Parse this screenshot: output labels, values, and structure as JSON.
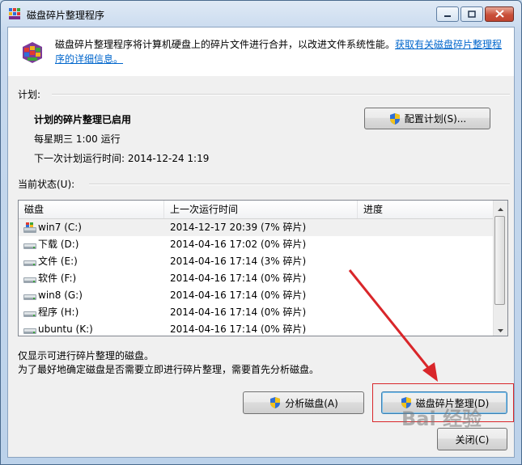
{
  "window": {
    "title": "磁盘碎片整理程序"
  },
  "header": {
    "description": "磁盘碎片整理程序将计算机硬盘上的碎片文件进行合并，以改进文件系统性能。",
    "link": "获取有关磁盘碎片整理程序的详细信息。"
  },
  "schedule": {
    "section_label": "计划:",
    "status": "计划的碎片整理已启用",
    "frequency": "每星期三  1:00 运行",
    "next_run": "下一次计划运行时间: 2014-12-24 1:19",
    "configure_button": "配置计划(S)..."
  },
  "current_status": {
    "section_label": "当前状态(U):",
    "columns": [
      "磁盘",
      "上一次运行时间",
      "进度"
    ],
    "rows": [
      {
        "disk": "win7 (C:)",
        "last_run": "2014-12-17 20:39 (7% 碎片)",
        "progress": ""
      },
      {
        "disk": "下载 (D:)",
        "last_run": "2014-04-16 17:02 (0% 碎片)",
        "progress": ""
      },
      {
        "disk": "文件 (E:)",
        "last_run": "2014-04-16 17:14 (3% 碎片)",
        "progress": ""
      },
      {
        "disk": "软件 (F:)",
        "last_run": "2014-04-16 17:14 (0% 碎片)",
        "progress": ""
      },
      {
        "disk": "win8 (G:)",
        "last_run": "2014-04-16 17:14 (0% 碎片)",
        "progress": ""
      },
      {
        "disk": "程序 (H:)",
        "last_run": "2014-04-16 17:14 (0% 碎片)",
        "progress": ""
      },
      {
        "disk": "ubuntu (K:)",
        "last_run": "2014-04-16 17:14 (0% 碎片)",
        "progress": ""
      }
    ]
  },
  "notes": {
    "line1": "仅显示可进行碎片整理的磁盘。",
    "line2": "为了最好地确定磁盘是否需要立即进行碎片整理，需要首先分析磁盘。"
  },
  "buttons": {
    "analyze": "分析磁盘(A)",
    "defragment": "磁盘碎片整理(D)",
    "close": "关闭(C)"
  },
  "icons": {
    "title": "defrag-icon",
    "shield": "uac-shield-icon",
    "drive": "hard-drive-icon",
    "system_drive": "windows-drive-icon"
  },
  "colors": {
    "link": "#0066cc",
    "annotation": "#d9262a"
  },
  "watermark": "Bai 经验"
}
